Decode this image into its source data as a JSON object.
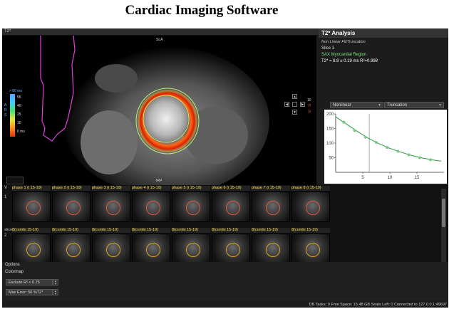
{
  "page_title": "Cardiac Imaging Software",
  "window": {
    "tab_label": "T2*"
  },
  "viewer": {
    "top_label": "SLA",
    "bottom_label": "IRP",
    "colorbar": {
      "max_label": "> 80 ms",
      "side_letters": "A R S",
      "ticks": [
        "55",
        "40",
        "25",
        "10",
        "0 ms"
      ]
    },
    "side_numbers": [
      "10",
      "P",
      "E"
    ]
  },
  "analysis": {
    "title": "T2* Analysis",
    "method": "Non Linear Fit/Truncation",
    "slice": "Slice 1",
    "region": "SAX Myocardial Region",
    "result": "T2* = 8.8 ± 0.19 ms R²=0.998",
    "fit_dropdown": "Nonlinear",
    "mode_dropdown": "Truncation",
    "colors": {
      "region": "#7fe07f",
      "curve": "#2e9a3e",
      "points": "#7cc68a"
    }
  },
  "chart_data": {
    "type": "scatter",
    "title": "",
    "xlabel": "",
    "ylabel": "",
    "xlim": [
      0,
      20
    ],
    "ylim": [
      0,
      200
    ],
    "x_ticks": [
      "5",
      "10",
      "15"
    ],
    "y_ticks": [
      "200",
      "150",
      "100",
      "50"
    ],
    "points_x": [
      1.5,
      3.5,
      5.5,
      7.5,
      9.5,
      11.5,
      13.5,
      15.5,
      17.5
    ],
    "points_y": [
      172,
      143,
      120,
      102,
      85,
      72,
      60,
      50,
      43
    ],
    "fit_curve_x": [
      0,
      2,
      4,
      6,
      8,
      10,
      12,
      14,
      16,
      18,
      19.5
    ],
    "fit_curve_y": [
      190,
      165,
      140,
      117,
      98,
      82,
      69,
      58,
      49,
      42,
      38
    ],
    "cursor_x": 6.2,
    "grid": false,
    "legend": "none"
  },
  "strip": {
    "row1": {
      "header": "V",
      "number": "1",
      "labels": [
        "phase 1 (i 15-19)",
        "phase 2 (i 15-19)",
        "phase 3 (i 15-19)",
        "phase 4 (i 15-19)",
        "phase 5 (i 15-19)",
        "phase 6 (i 15-19)",
        "phase 7 (i 15-19)",
        "phase 8 (i 15-19)"
      ]
    },
    "row2": {
      "header": "slice",
      "number": "2",
      "labels": [
        "8(combi 15-19)",
        "8(combi 15-19)",
        "8(combi 15-19)",
        "8(combi 15-19)",
        "8(combi 15-19)",
        "8(combi 15-19)",
        "8(combi 15-19)",
        "8(combi 15-19)"
      ]
    }
  },
  "options": {
    "title": "Options",
    "colormap": "Colormap",
    "exclude": "Exclude R² < 0.75",
    "max_error": "Max Error: 50 %T2*"
  },
  "status": "DB Tasks: 0  Free Space: 15.48 GB  Seats Left: 0  Connected to 127.0.0.1:49697"
}
